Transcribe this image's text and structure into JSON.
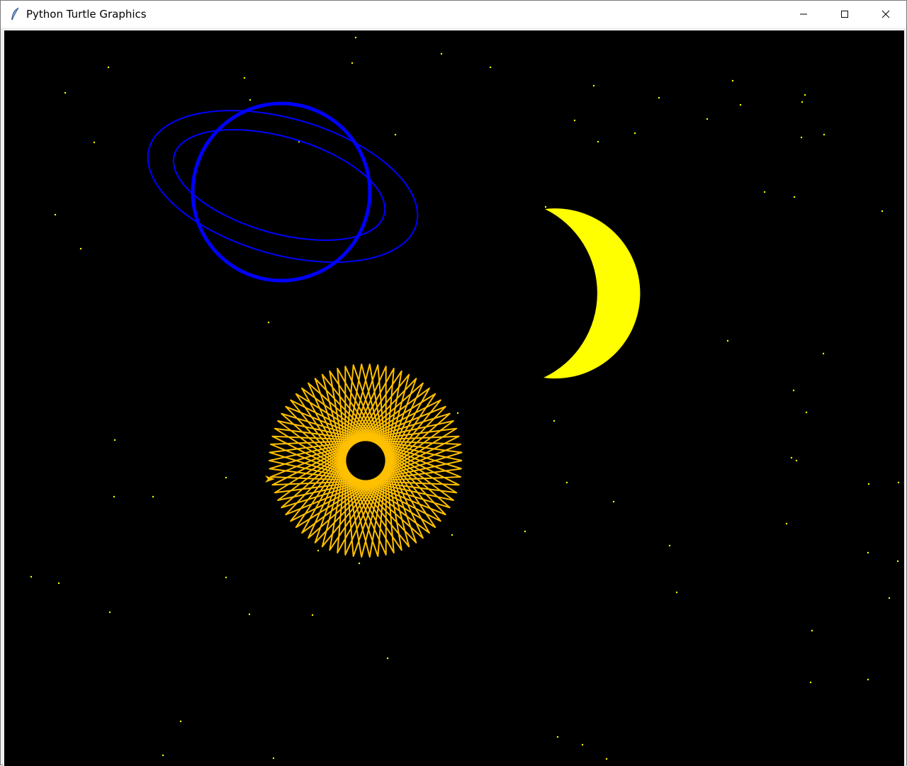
{
  "window": {
    "title": "Python Turtle Graphics",
    "icon": "feather-icon",
    "controls": {
      "minimize_icon": "minimize-icon",
      "maximize_icon": "maximize-icon",
      "close_icon": "close-icon"
    }
  },
  "canvas": {
    "background": "#000000",
    "colors": {
      "stars": "#ffff00",
      "planet": "#0000ff",
      "moon": "#ffff00",
      "spirograph": "#ffc000"
    }
  }
}
